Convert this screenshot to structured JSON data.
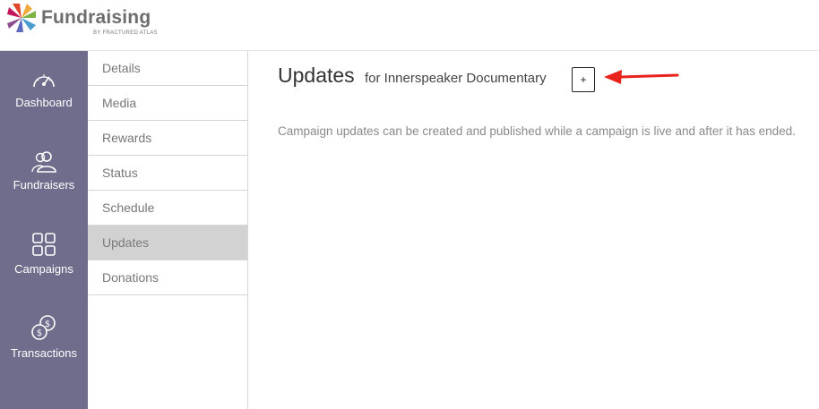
{
  "brand": {
    "title": "Fundraising",
    "subtitle": "BY FRACTURED ATLAS"
  },
  "sidebar": {
    "items": [
      {
        "label": "Dashboard",
        "icon": "speedometer-icon"
      },
      {
        "label": "Fundraisers",
        "icon": "users-icon"
      },
      {
        "label": "Campaigns",
        "icon": "grid-icon"
      },
      {
        "label": "Transactions",
        "icon": "coins-icon"
      }
    ]
  },
  "subnav": {
    "items": [
      {
        "label": "Details"
      },
      {
        "label": "Media"
      },
      {
        "label": "Rewards"
      },
      {
        "label": "Status"
      },
      {
        "label": "Schedule"
      },
      {
        "label": "Updates",
        "active": true
      },
      {
        "label": "Donations"
      }
    ]
  },
  "main": {
    "title": "Updates",
    "subtitle": "for Innerspeaker Documentary",
    "add_label": "+",
    "info": "Campaign updates can be created and published while a campaign is live and after it has ended."
  },
  "colors": {
    "sidebar_bg": "#6f6c8c",
    "active_subnav": "#d2d2d2",
    "arrow": "#e8231b"
  }
}
